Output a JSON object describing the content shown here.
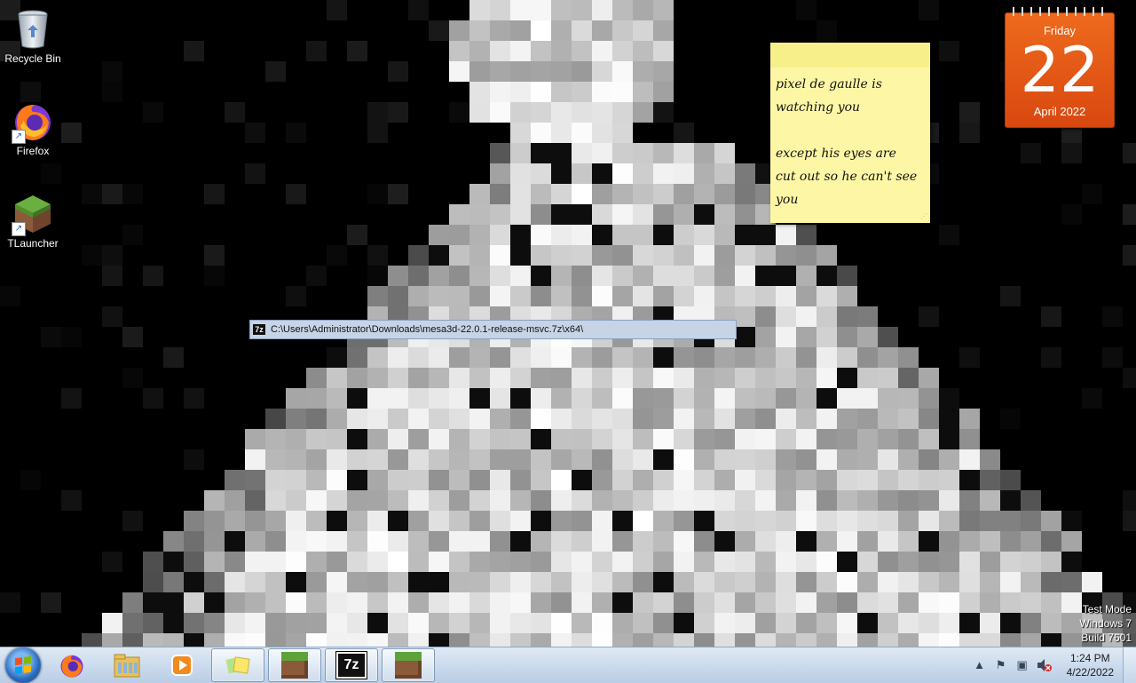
{
  "desktop": {
    "icons": [
      {
        "label": "Recycle Bin",
        "icon": "recycle-bin-icon"
      },
      {
        "label": "Firefox",
        "icon": "firefox-icon"
      },
      {
        "label": "TLauncher",
        "icon": "minecraft-grass-block-icon"
      }
    ]
  },
  "sticky_note": {
    "text": "pixel de gaulle is\nwatching you\n\nexcept his eyes are\ncut out so he can't see\nyou"
  },
  "calendar_gadget": {
    "weekday": "Friday",
    "day": "22",
    "month_year": "April 2022",
    "accent": "#e25a14"
  },
  "path_bar": {
    "path": "C:\\Users\\Administrator\\Downloads\\mesa3d-22.0.1-release-msvc.7z\\x64\\",
    "icon": "7zip-icon"
  },
  "watermark": {
    "line1": "Test Mode",
    "line2": "Windows 7",
    "line3": "Build 7601"
  },
  "taskbar": {
    "start_icon": "windows-start-orb-icon",
    "pinned": [
      {
        "name": "firefox",
        "icon": "firefox-icon"
      },
      {
        "name": "explorer",
        "icon": "folder-icon"
      },
      {
        "name": "media-player",
        "icon": "media-player-icon"
      },
      {
        "name": "sticky-notes",
        "icon": "sticky-notes-icon"
      },
      {
        "name": "tlauncher",
        "icon": "minecraft-grass-block-icon"
      },
      {
        "name": "7zip",
        "icon": "7zip-icon"
      },
      {
        "name": "minecraft",
        "icon": "minecraft-grass-block-icon"
      }
    ],
    "sevenzip_label": "7z",
    "tray": {
      "icons": [
        "show-hidden-icons-icon",
        "action-center-flag-icon",
        "network-icon",
        "volume-muted-icon"
      ],
      "time": "1:24 PM",
      "date": "4/22/2022"
    }
  }
}
